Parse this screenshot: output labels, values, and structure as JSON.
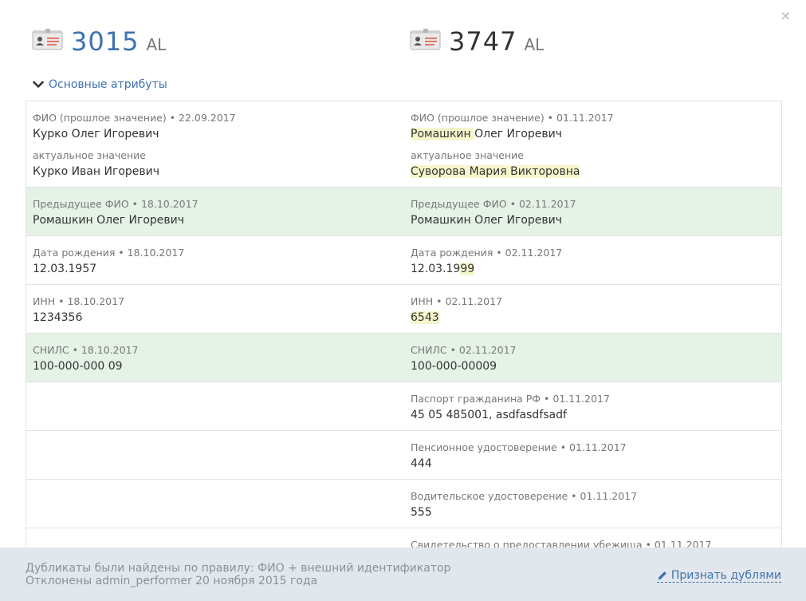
{
  "close_label": "×",
  "left_card": {
    "number": "3015",
    "suffix": "AL",
    "icon": "id-card-icon"
  },
  "right_card": {
    "number": "3747",
    "suffix": "AL",
    "icon": "id-card-icon"
  },
  "section": {
    "title": "Основные атрибуты",
    "icon": "chevron-down-icon"
  },
  "rows": [
    {
      "left": {
        "label": "ФИО (прошлое значение) • 22.09.2017",
        "value": "Курко Олег Игоревич",
        "sub_label": "актуальное значение",
        "sub_value": "Курко Иван Игоревич"
      },
      "right": {
        "label": "ФИО (прошлое значение) • 01.11.2017",
        "value_hl": "Ромашкин ",
        "value_rest": "Олег Игоревич",
        "sub_label": "актуальное значение",
        "sub_value": "Суворова Мария Викторовна"
      }
    },
    {
      "left": {
        "label": "Предыдущее ФИО • 18.10.2017",
        "value": "Ромашкин Олег Игоревич"
      },
      "right": {
        "label": "Предыдущее ФИО • 02.11.2017",
        "value": "Ромашкин Олег Игоревич"
      }
    },
    {
      "left": {
        "label": "Дата рождения • 18.10.2017",
        "value": "12.03.1957"
      },
      "right": {
        "label": "Дата рождения • 02.11.2017",
        "value_plain": "12.03.19",
        "value_hl": "99"
      }
    },
    {
      "left": {
        "label": "ИНН • 18.10.2017",
        "value": "1234356"
      },
      "right": {
        "label": "ИНН • 02.11.2017",
        "value": "6543"
      }
    },
    {
      "left": {
        "label": "СНИЛС • 18.10.2017",
        "value": "100-000-000 09"
      },
      "right": {
        "label": "СНИЛС • 02.11.2017",
        "value": "100-000-00009"
      }
    },
    {
      "right": {
        "label": "Паспорт гражданина РФ • 01.11.2017",
        "value": "45 05 485001, asdfasdfsadf"
      }
    },
    {
      "right": {
        "label": "Пенсионное удостоверение • 01.11.2017",
        "value": "444"
      }
    },
    {
      "right": {
        "label": "Водительское удостоверение • 01.11.2017",
        "value": "555"
      }
    },
    {
      "right": {
        "label": "Свидетельство о предоставлении убежища • 01.11.2017",
        "value": ""
      }
    }
  ],
  "footer": {
    "line1": "Дубликаты были найдены по правилу: ФИО + внешний идентификатор",
    "line2": "Отклонены admin_performer 20 ноября 2015 года",
    "confirm_label": "Признать дублями",
    "confirm_icon": "pencil-icon"
  },
  "colors": {
    "accent": "#3f72b0",
    "highlight": "#f6f6cc",
    "green_row": "#e5f2e6",
    "footer_bg": "#e2e7ed"
  }
}
